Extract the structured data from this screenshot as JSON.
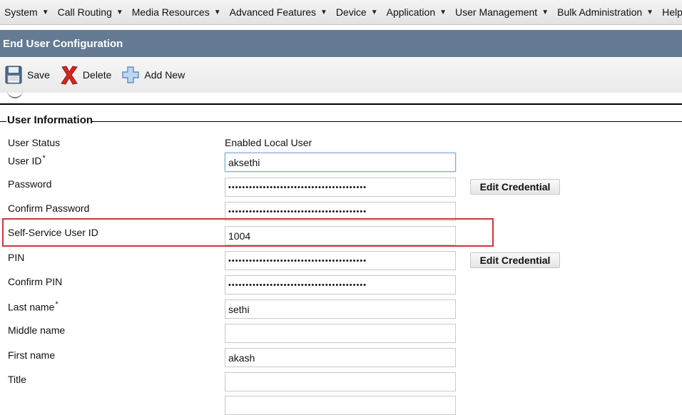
{
  "menu": [
    {
      "label": "System"
    },
    {
      "label": "Call Routing"
    },
    {
      "label": "Media Resources"
    },
    {
      "label": "Advanced Features"
    },
    {
      "label": "Device"
    },
    {
      "label": "Application"
    },
    {
      "label": "User Management"
    },
    {
      "label": "Bulk Administration"
    },
    {
      "label": "Help"
    }
  ],
  "page_title": "End User Configuration",
  "toolbar": {
    "save_label": "Save",
    "delete_label": "Delete",
    "add_new_label": "Add New"
  },
  "section_title": "User Information",
  "fields": {
    "user_status": {
      "label": "User Status",
      "value": "Enabled Local User"
    },
    "user_id": {
      "label": "User ID",
      "required": "*",
      "value": "aksethi"
    },
    "password": {
      "label": "Password",
      "value": "••••••••••••••••••••••••••••••••••••••••"
    },
    "confirm_password": {
      "label": "Confirm Password",
      "value": "••••••••••••••••••••••••••••••••••••••••"
    },
    "self_service_user_id": {
      "label": "Self-Service User ID",
      "value": "1004"
    },
    "pin": {
      "label": "PIN",
      "value": "••••••••••••••••••••••••••••••••••••••••"
    },
    "confirm_pin": {
      "label": "Confirm PIN",
      "value": "••••••••••••••••••••••••••••••••••••••••"
    },
    "last_name": {
      "label": "Last name",
      "required": "*",
      "value": "sethi"
    },
    "middle_name": {
      "label": "Middle name",
      "value": ""
    },
    "first_name": {
      "label": "First name",
      "value": "akash"
    },
    "title": {
      "label": "Title",
      "value": ""
    }
  },
  "buttons": {
    "edit_credential_password": "Edit Credential",
    "edit_credential_pin": "Edit Credential"
  },
  "colors": {
    "title_bar": "#647b93",
    "highlight": "#d0343a"
  }
}
